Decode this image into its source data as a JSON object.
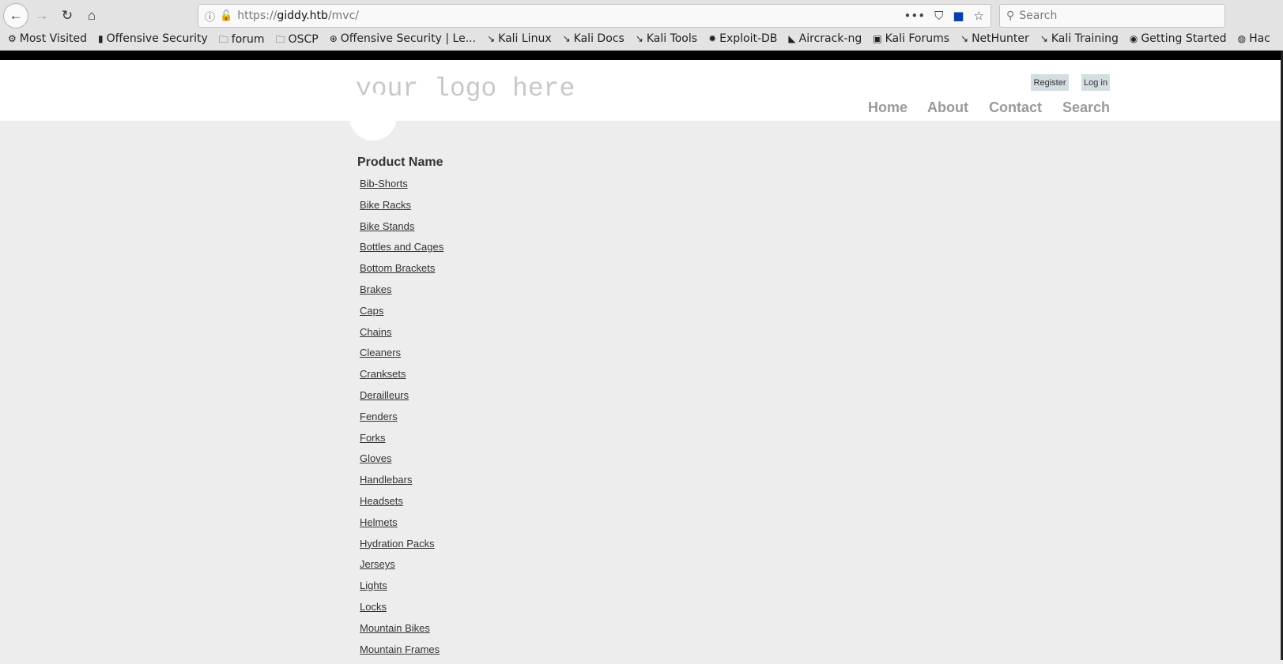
{
  "browser": {
    "url_prefix": "https://",
    "url_host": "giddy.htb",
    "url_path": "/mvc/",
    "search_placeholder": "Search",
    "bookmarks": [
      "Most Visited",
      "Offensive Security",
      "forum",
      "OSCP",
      "Offensive Security | Le...",
      "Kali Linux",
      "Kali Docs",
      "Kali Tools",
      "Exploit-DB",
      "Aircrack-ng",
      "Kali Forums",
      "NetHunter",
      "Kali Training",
      "Getting Started",
      "Hac"
    ]
  },
  "header": {
    "logo": "your logo here",
    "register": "Register",
    "login": "Log in",
    "nav": [
      "Home",
      "About",
      "Contact",
      "Search"
    ]
  },
  "main": {
    "heading": "Product Name",
    "products": [
      "Bib-Shorts",
      "Bike Racks",
      "Bike Stands",
      "Bottles and Cages",
      "Bottom Brackets",
      "Brakes",
      "Caps",
      "Chains",
      "Cleaners",
      "Cranksets",
      "Derailleurs",
      "Fenders",
      "Forks",
      "Gloves",
      "Handlebars",
      "Headsets",
      "Helmets",
      "Hydration Packs",
      "Jerseys",
      "Lights",
      "Locks",
      "Mountain Bikes",
      "Mountain Frames"
    ]
  }
}
